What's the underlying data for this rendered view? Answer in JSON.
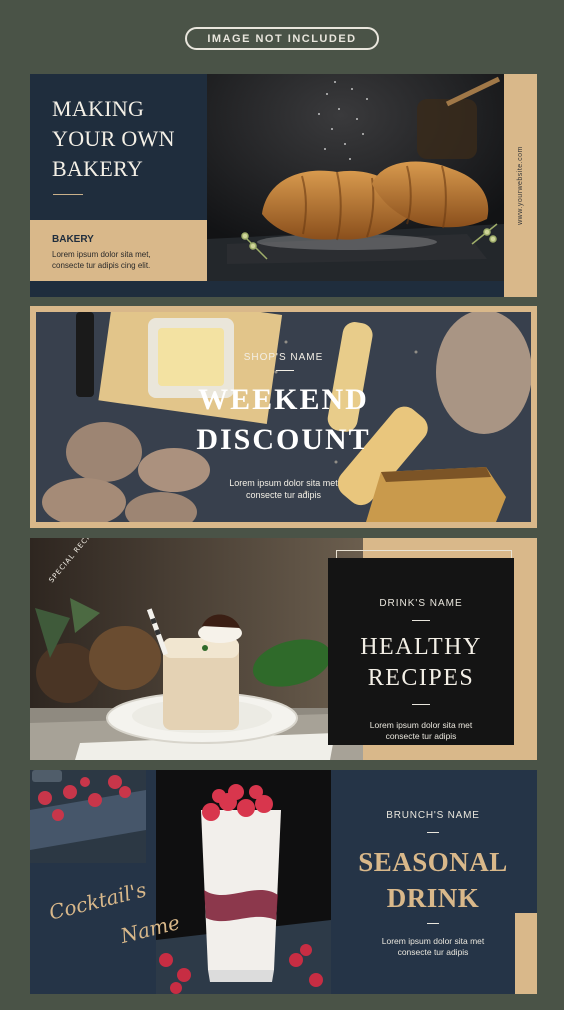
{
  "header": {
    "badge": "IMAGE NOT INCLUDED"
  },
  "banners": [
    {
      "title_lines": [
        "MAKING",
        "YOUR OWN",
        "BAKERY"
      ],
      "category": "BAKERY",
      "description_lines": [
        "Lorem ipsum dolor sita met,",
        "consecte tur adipis cing elit."
      ],
      "website": "www.yourwebsite.com"
    },
    {
      "eyebrow": "SHOP'S NAME",
      "title_lines": [
        "WEEKEND",
        "DISCOUNT"
      ],
      "description_lines": [
        "Lorem ipsum dolor sita met",
        "consecte tur adipis"
      ]
    },
    {
      "badge": "SPECIAL RECIPES",
      "eyebrow": "DRINK'S NAME",
      "title_lines": [
        "HEALTHY",
        "RECIPES"
      ],
      "description_lines": [
        "Lorem ipsum dolor sita met",
        "consecte tur adipis"
      ]
    },
    {
      "script_lines": [
        "Cocktail's",
        "Name"
      ],
      "eyebrow": "BRUNCH'S NAME",
      "title_lines": [
        "SEASONAL",
        "DRINK"
      ],
      "description_lines": [
        "Lorem ipsum dolor sita met",
        "consecte tur adipis"
      ]
    }
  ],
  "colors": {
    "background": "#4a5347",
    "navy": "#1f2d3d",
    "tan": "#d9b88a",
    "black_box": "#141414",
    "cream": "#f3efe6"
  }
}
